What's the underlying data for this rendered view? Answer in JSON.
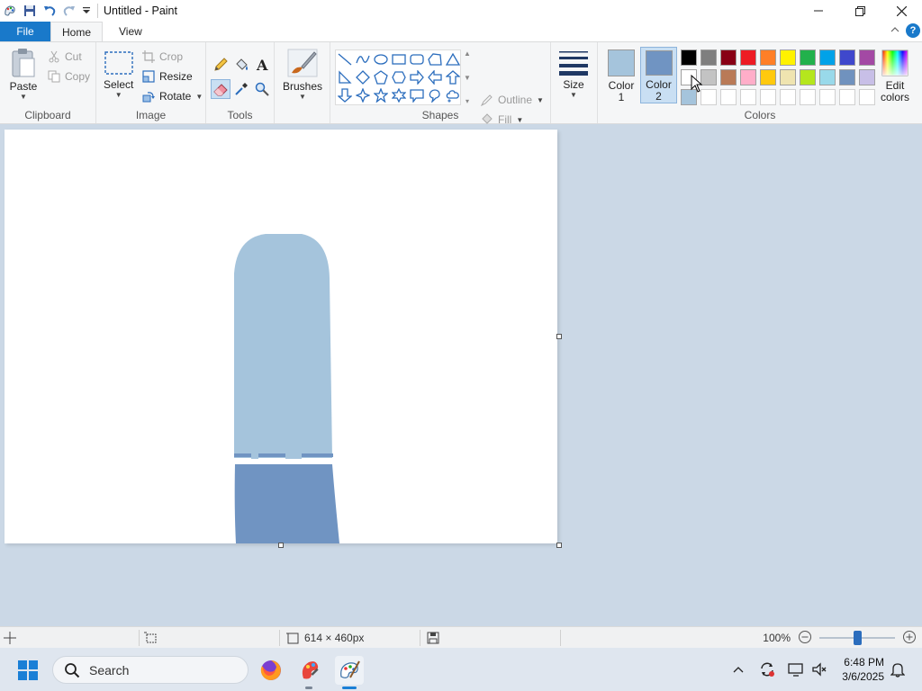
{
  "titlebar": {
    "title": "Untitled - Paint"
  },
  "menu": {
    "file": "File",
    "home": "Home",
    "view": "View"
  },
  "ribbon": {
    "clipboard": {
      "paste": "Paste",
      "cut": "Cut",
      "copy": "Copy",
      "label": "Clipboard"
    },
    "image": {
      "select": "Select",
      "crop": "Crop",
      "resize": "Resize",
      "rotate": "Rotate",
      "label": "Image"
    },
    "tools": {
      "label": "Tools"
    },
    "brushes": {
      "label": "Brushes"
    },
    "shapes": {
      "outline": "Outline",
      "fill": "Fill",
      "label": "Shapes"
    },
    "size": {
      "label": "Size"
    },
    "colors": {
      "color1_line1": "Color",
      "color1_line2": "1",
      "color2_line1": "Color",
      "color2_line2": "2",
      "edit_line1": "Edit",
      "edit_line2": "colors",
      "label": "Colors",
      "color1_value": "#a5c4dc",
      "color2_value": "#7094c2",
      "palette": [
        "#000000",
        "#7f7f7f",
        "#880015",
        "#ed1c24",
        "#ff7f27",
        "#fff200",
        "#22b14c",
        "#00a2e8",
        "#3f48cc",
        "#a349a4",
        "#ffffff",
        "#c3c3c3",
        "#b97a57",
        "#ffaec9",
        "#ffc90e",
        "#efe4b0",
        "#b5e61d",
        "#99d9ea",
        "#7092be",
        "#c8bfe7",
        "#a5c4dc",
        "#ffffff",
        "#ffffff",
        "#ffffff",
        "#ffffff",
        "#ffffff",
        "#ffffff",
        "#ffffff",
        "#ffffff",
        "#ffffff"
      ]
    }
  },
  "canvas": {
    "fill_top": "#a5c4dc",
    "fill_bottom": "#7094c2"
  },
  "status": {
    "dimensions": "614 × 460px",
    "zoom": "100%",
    "zoom_level": 0.5
  },
  "taskbar": {
    "search": "Search",
    "time": "6:48 PM",
    "date": "3/6/2025"
  }
}
